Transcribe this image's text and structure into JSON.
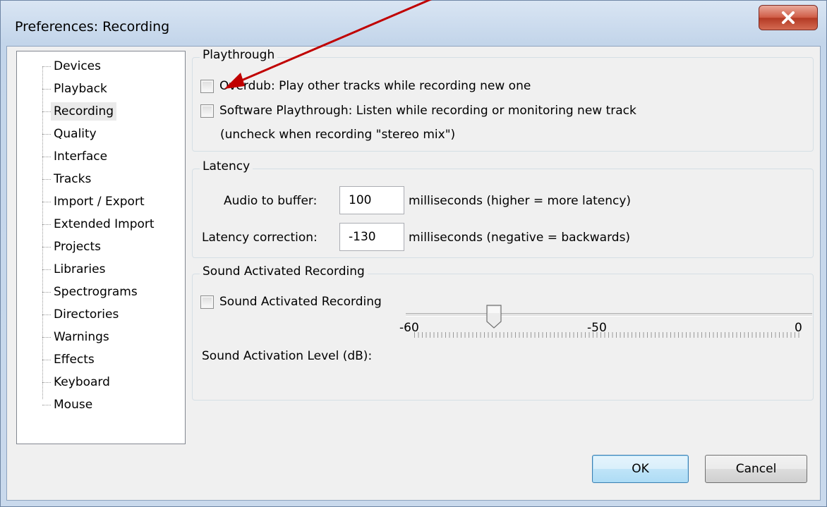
{
  "window": {
    "title": "Preferences: Recording"
  },
  "sidebar": {
    "items": [
      {
        "label": "Devices"
      },
      {
        "label": "Playback"
      },
      {
        "label": "Recording"
      },
      {
        "label": "Quality"
      },
      {
        "label": "Interface"
      },
      {
        "label": "Tracks"
      },
      {
        "label": "Import / Export"
      },
      {
        "label": "Extended Import"
      },
      {
        "label": "Projects"
      },
      {
        "label": "Libraries"
      },
      {
        "label": "Spectrograms"
      },
      {
        "label": "Directories"
      },
      {
        "label": "Warnings"
      },
      {
        "label": "Effects"
      },
      {
        "label": "Keyboard"
      },
      {
        "label": "Mouse"
      }
    ],
    "selected": "Recording"
  },
  "playthrough": {
    "legend": "Playthrough",
    "overdub_label": "Overdub: Play other tracks while recording new one",
    "overdub_checked": false,
    "software_label": "Software Playthrough: Listen while recording or monitoring new track",
    "software_checked": false,
    "software_note": "(uncheck when recording \"stereo mix\")"
  },
  "latency": {
    "legend": "Latency",
    "buffer_label": "Audio to buffer:",
    "buffer_value": "100",
    "buffer_unit": "milliseconds (higher = more latency)",
    "correction_label": "Latency correction:",
    "correction_value": "-130",
    "correction_unit": "milliseconds (negative = backwards)"
  },
  "sound_activated": {
    "legend": "Sound Activated Recording",
    "checkbox_label": "Sound Activated Recording",
    "checked": false,
    "scale_min": "-60",
    "scale_mid": "-50",
    "scale_max": "0",
    "level_label": "Sound Activation Level (dB):",
    "level_value": -50
  },
  "buttons": {
    "ok": "OK",
    "cancel": "Cancel"
  },
  "colors": {
    "annotation_arrow": "#c00000"
  }
}
